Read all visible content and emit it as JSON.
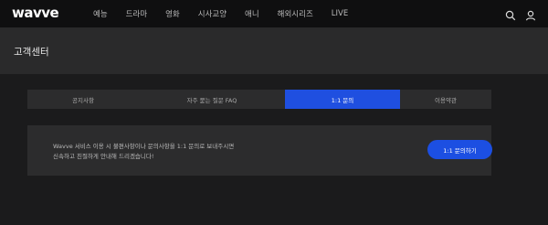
{
  "brand": {
    "logo": "wavve"
  },
  "nav": {
    "items": [
      "예능",
      "드라마",
      "영화",
      "시사교양",
      "애니",
      "해외시리즈",
      "LIVE"
    ]
  },
  "util": {
    "search_icon": "search-icon",
    "user_icon": "user-icon"
  },
  "page": {
    "title": "고객센터"
  },
  "tabs": [
    {
      "label": "공지사항",
      "active": false
    },
    {
      "label": "자주 묻는 질문 FAQ",
      "active": false
    },
    {
      "label": "1:1 문의",
      "active": true
    },
    {
      "label": "이용약관",
      "active": false
    }
  ],
  "inquiry": {
    "lines": [
      "Wavve 서비스 이용 시 불편사항이나 문의사항을 1:1 문의로 보내주시면",
      "신속하고 친절하게 안내해 드리겠습니다!"
    ],
    "button_label": "1:1 문의하기"
  },
  "colors": {
    "accent": "#1f4fe0",
    "background": "#1b1b1c",
    "panel": "#2c2c2d"
  }
}
